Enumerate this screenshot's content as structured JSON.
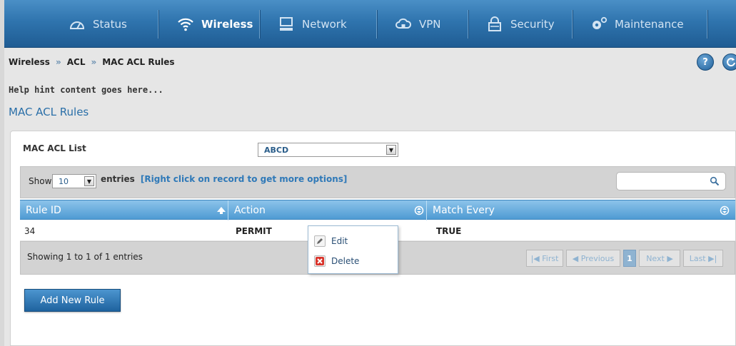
{
  "nav": {
    "items": [
      {
        "label": "Status",
        "icon": "dashboard-icon"
      },
      {
        "label": "Wireless",
        "icon": "wifi-icon"
      },
      {
        "label": "Network",
        "icon": "computer-icon"
      },
      {
        "label": "VPN",
        "icon": "cloud-lock-icon"
      },
      {
        "label": "Security",
        "icon": "padlock-icon"
      },
      {
        "label": "Maintenance",
        "icon": "gears-icon"
      }
    ],
    "active": "Wireless"
  },
  "breadcrumb": {
    "items": [
      "Wireless",
      "ACL",
      "MAC ACL Rules"
    ],
    "separator": "»"
  },
  "help_button": "?",
  "hint": "Help hint content goes here...",
  "page_title": "MAC ACL Rules",
  "acl": {
    "label": "MAC ACL List",
    "selected": "ABCD"
  },
  "table_controls": {
    "show_label": "Show",
    "entries_value": "10",
    "entries_label": "entries",
    "entries_hint": "[Right click on record to get more options]"
  },
  "table": {
    "columns": [
      "Rule ID",
      "Action",
      "Match Every"
    ],
    "rows": [
      {
        "rule_id": "34",
        "action": "PERMIT",
        "match_every": "TRUE"
      }
    ]
  },
  "context_menu": {
    "items": [
      {
        "label": "Edit",
        "icon": "pencil-icon"
      },
      {
        "label": "Delete",
        "icon": "delete-x-icon"
      }
    ]
  },
  "footer": {
    "showing": "Showing 1 to 1 of 1 entries"
  },
  "pagination": {
    "first": "First",
    "previous": "Previous",
    "current": "1",
    "next": "Next",
    "last": "Last"
  },
  "add_button": "Add New Rule",
  "colors": {
    "nav_blue": "#2f74ae",
    "header_blue": "#4f9bd3",
    "title_blue": "#2a6fa8"
  }
}
